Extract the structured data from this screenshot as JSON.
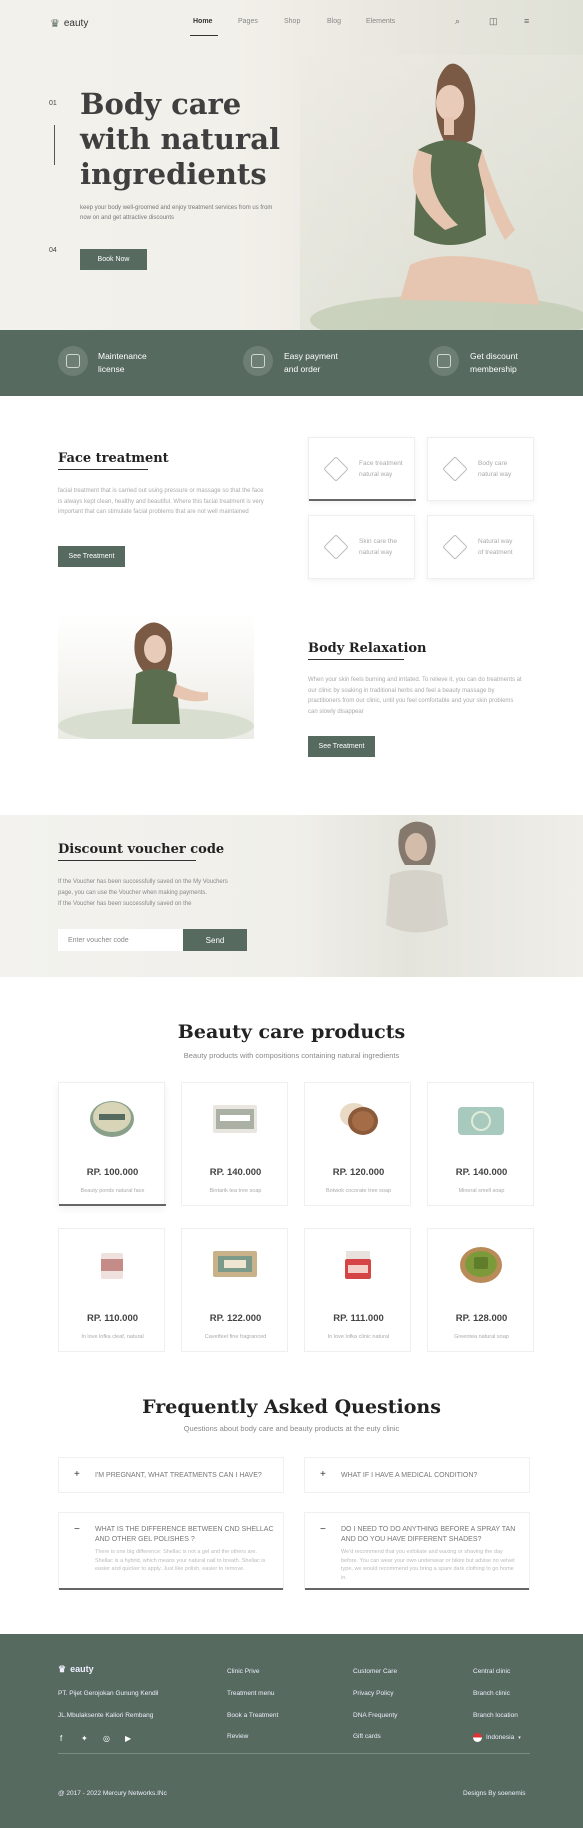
{
  "nav": {
    "brand": "eauty",
    "items": [
      "Home",
      "Pages",
      "Shop",
      "Blog",
      "Elements"
    ],
    "icons": [
      "search-icon",
      "cart-icon",
      "menu-icon"
    ]
  },
  "hero": {
    "slide_start": "01",
    "slide_end": "04",
    "title": "Body care with natural ingredients",
    "subtitle": "keep your body well-groomed and enjoy treatment services from us from now on and get attractive discounts",
    "cta": "Book Now"
  },
  "features": [
    {
      "l1": "Maintenance",
      "l2": "license"
    },
    {
      "l1": "Easy payment",
      "l2": "and order"
    },
    {
      "l1": "Get discount",
      "l2": "membership"
    }
  ],
  "face": {
    "title": "Face treatment",
    "text": "facial treatment that is carried out using pressure or massage so that the face is always kept clean, healthy and beautiful. Where this facial treatment is very important that can stimulate facial problems that are not well maintained",
    "cta": "See Treatment",
    "cards": [
      {
        "l1": "Face treatment",
        "l2": "natural way"
      },
      {
        "l1": "Body care",
        "l2": "natural way"
      },
      {
        "l1": "Skin care the",
        "l2": "natural way"
      },
      {
        "l1": "Natural way",
        "l2": "of treatment"
      }
    ]
  },
  "relax": {
    "title": "Body Relaxation",
    "text": "When your skin feels burning and irritated. To relieve it, you can do treatments at our clinic by soaking in traditional herbs and feel a beauty massage by practitioners from our clinic, until you feel comfortable and your skin problems can slowly disappear",
    "cta": "See Treatment"
  },
  "voucher": {
    "title": "Discount voucher code",
    "line1": "If the Voucher has been successfully saved on the My Vouchers",
    "line2": "page, you can use the Voucher when making payments.",
    "line3": "If the Voucher has been successfully saved on the",
    "placeholder": "Enter voucher code",
    "send": "Send"
  },
  "products": {
    "title": "Beauty care products",
    "subtitle": "Beauty products with compositions containing natural ingredients",
    "items": [
      {
        "price": "RP. 100.000",
        "name": "Beauty ponds natural face"
      },
      {
        "price": "RP. 140.000",
        "name": "Bintarik tea tree soap"
      },
      {
        "price": "RP. 120.000",
        "name": "Botwok cocorate tree soap"
      },
      {
        "price": "RP. 140.000",
        "name": "Mineral smell soap"
      },
      {
        "price": "RP. 110.000",
        "name": "In love lofka cleaf, natural"
      },
      {
        "price": "RP. 122.000",
        "name": "Cavetfeel fine fragranced"
      },
      {
        "price": "RP. 111.000",
        "name": "In love lofka clinic natural"
      },
      {
        "price": "RP. 128.000",
        "name": "Greentea natural soap"
      }
    ]
  },
  "faq": {
    "title": "Frequently Asked Questions",
    "subtitle": "Questions about body care and beauty products at the euty clinic",
    "items": [
      {
        "sign": "+",
        "q": "I'M PREGNANT, WHAT TREATMENTS CAN I HAVE?",
        "a": ""
      },
      {
        "sign": "+",
        "q": "WHAT IF I HAVE A MEDICAL CONDITION?",
        "a": ""
      },
      {
        "sign": "−",
        "q": "WHAT IS THE DIFFERENCE BETWEEN CND SHELLAC AND OTHER GEL POLISHES ?",
        "a": "There is one big difference: Shellac is not a gel and the others are. Shellac is a hybrid, which means your natural nail to breath. Shellac is easier and quicker to apply. Just like polish, easier to remove."
      },
      {
        "sign": "−",
        "q": "DO I NEED TO DO ANYTHING BEFORE A SPRAY TAN AND DO YOU HAVE DIFFERENT SHADES?",
        "a": "We'd recommend that you exfoliate and waxing or shaving the day before. You can wear your own underwear or bikini but advise no velvet type, we would recommend you bring a spare dark clothing to go home in."
      }
    ]
  },
  "footer": {
    "brand": "eauty",
    "addr1": "PT. Pijet Gerojokan Gunung Kendil",
    "addr2": "JL.Mbulaksente Kaliori Rembang",
    "col2": [
      "Clinic Prive",
      "Treatment menu",
      "Book a Treatment",
      "Review"
    ],
    "col3": [
      "Customer Care",
      "Privacy Policy",
      "DNA Frequenty",
      "Gift cards"
    ],
    "col4": [
      "Central clinic",
      "Branch clinic",
      "Branch location"
    ],
    "lang": "Indonesia",
    "copyright": "@ 2017 - 2022 Mercury Networks.INc",
    "credit": "Designs By soenemis",
    "socials": [
      "facebook-icon",
      "twitter-icon",
      "instagram-icon",
      "youtube-icon"
    ]
  },
  "colors": {
    "accent": "#566a5f",
    "text": "#333333",
    "muted": "#aaaaaa"
  }
}
